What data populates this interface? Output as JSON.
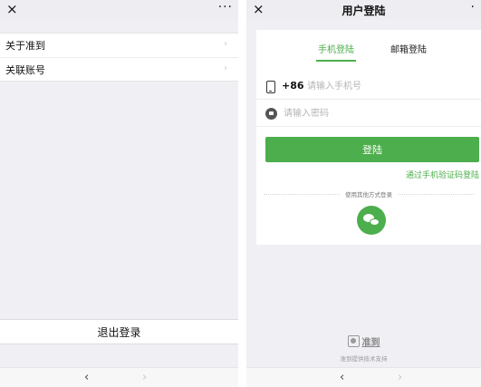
{
  "left": {
    "navbar": {
      "close_glyph": "×",
      "more_glyph": "···"
    },
    "menu": [
      {
        "label": "关于准到",
        "chevron": "›"
      },
      {
        "label": "关联账号",
        "chevron": "›"
      }
    ],
    "logout_label": "退出登录",
    "toolbar": {
      "back_glyph": "‹",
      "forward_glyph": "›"
    }
  },
  "right": {
    "navbar": {
      "close_glyph": "×",
      "title": "用户登陆",
      "more_glyph": "·"
    },
    "tabs": [
      {
        "label": "手机登陆",
        "active": true
      },
      {
        "label": "邮箱登陆",
        "active": false
      }
    ],
    "phone": {
      "country_code": "+86",
      "placeholder": "请输入手机号",
      "value": ""
    },
    "password": {
      "placeholder": "请输入密码",
      "value": ""
    },
    "login_button": "登陆",
    "sms_login_link": "通过手机验证码登陆",
    "other_methods_label": "使用其他方式登录",
    "brand": {
      "name": "准到",
      "tagline": "准到提供技术支持"
    },
    "toolbar": {
      "back_glyph": "‹",
      "forward_glyph": "›"
    }
  },
  "icons": {
    "close": "close-icon",
    "more": "more-icon",
    "phone": "phone-icon",
    "lock": "lock-icon",
    "wechat": "wechat-icon",
    "chevron": "chevron-right-icon",
    "back": "chevron-left-icon",
    "brand": "brand-logo-icon"
  },
  "colors": {
    "accent_green": "#4cae4c",
    "background": "#efeff4",
    "card": "#ffffff",
    "placeholder": "#b5b5b5"
  }
}
